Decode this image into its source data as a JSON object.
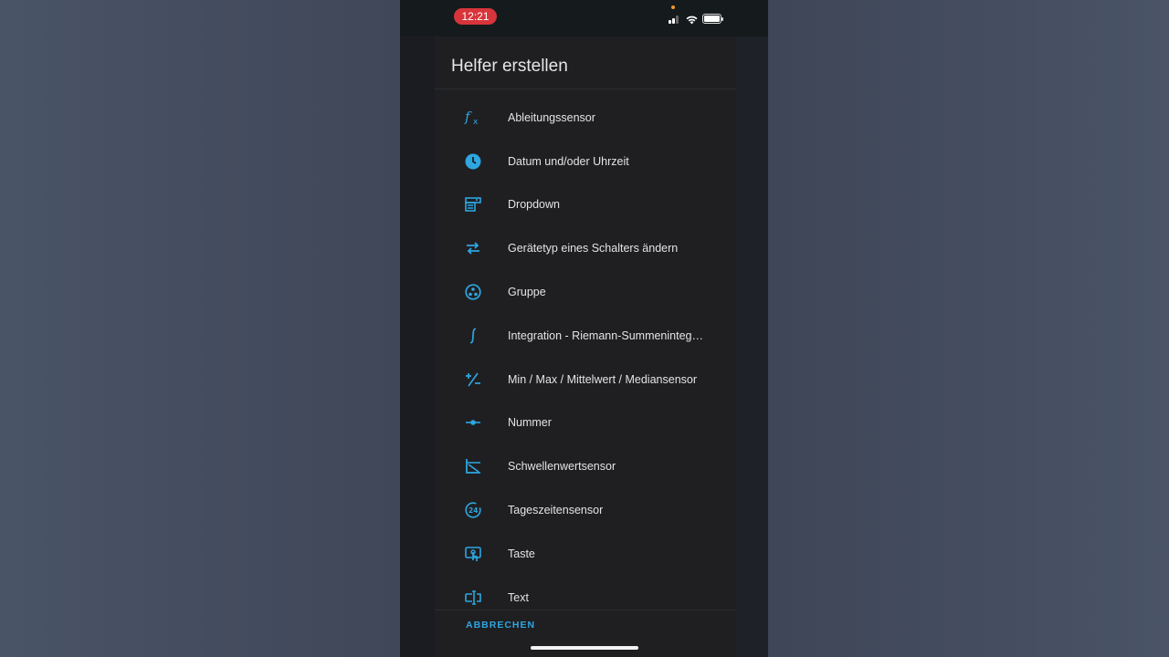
{
  "statusbar": {
    "time": "12:21"
  },
  "dialog": {
    "title": "Helfer erstellen",
    "items": [
      {
        "label": "Ableitungssensor",
        "icon": "function-icon"
      },
      {
        "label": "Datum und/oder Uhrzeit",
        "icon": "clock-icon"
      },
      {
        "label": "Dropdown",
        "icon": "dropdown-form-icon"
      },
      {
        "label": "Gerätetyp eines Schalters ändern",
        "icon": "swap-arrows-icon"
      },
      {
        "label": "Gruppe",
        "icon": "group-circle-icon"
      },
      {
        "label": "Integration - Riemann-Summenintegral…",
        "icon": "integral-icon"
      },
      {
        "label": "Min / Max / Mittelwert / Mediansensor",
        "icon": "plus-minus-icon"
      },
      {
        "label": "Nummer",
        "icon": "slider-icon"
      },
      {
        "label": "Schwellenwertsensor",
        "icon": "threshold-icon"
      },
      {
        "label": "Tageszeitensensor",
        "icon": "time-24-icon"
      },
      {
        "label": "Taste",
        "icon": "gesture-tap-button-icon"
      },
      {
        "label": "Text",
        "icon": "text-field-icon"
      }
    ],
    "cancel_label": "ABBRECHEN"
  },
  "colors": {
    "accent": "#2ea6e0",
    "dialog_bg": "#1f1f22",
    "time_pill": "#d8343b"
  }
}
